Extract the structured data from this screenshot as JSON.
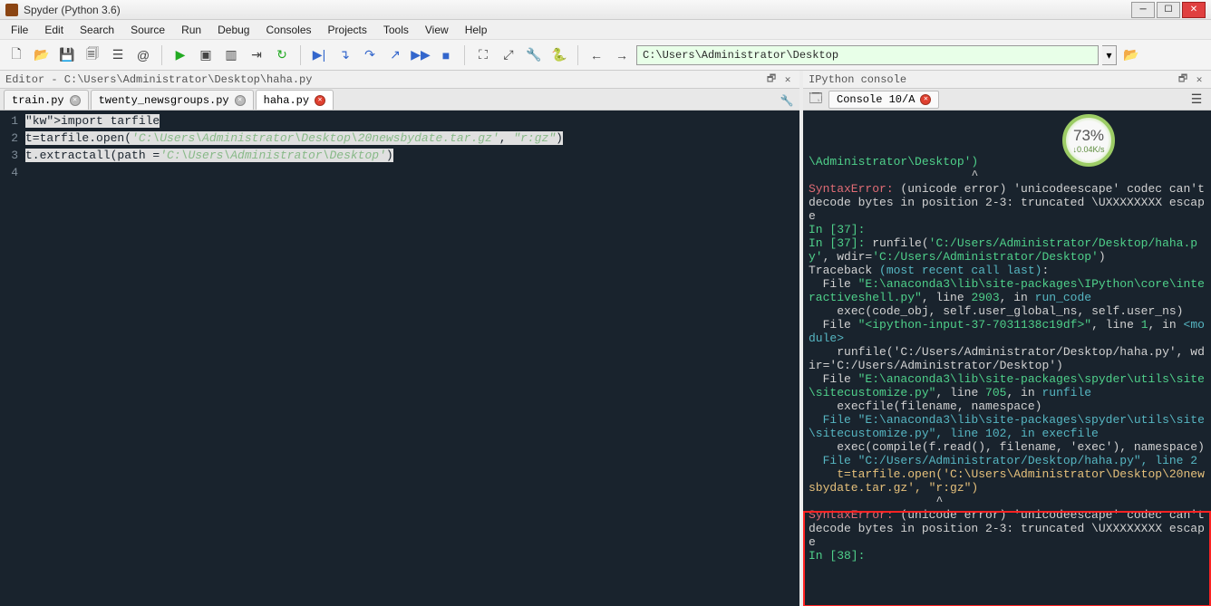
{
  "title": "Spyder (Python 3.6)",
  "menus": [
    "File",
    "Edit",
    "Search",
    "Source",
    "Run",
    "Debug",
    "Consoles",
    "Projects",
    "Tools",
    "View",
    "Help"
  ],
  "path_field": "C:\\Users\\Administrator\\Desktop",
  "editor_header": "Editor - C:\\Users\\Administrator\\Desktop\\haha.py",
  "editor_tabs": [
    {
      "label": "train.py",
      "close": "grey"
    },
    {
      "label": "twenty_newsgroups.py",
      "close": "grey"
    },
    {
      "label": "haha.py",
      "close": "red",
      "active": true
    }
  ],
  "code_lines": [
    {
      "n": "1",
      "raw": "import tarfile",
      "hl": true
    },
    {
      "n": "2",
      "raw": "t=tarfile.open('C:\\Users\\Administrator\\Desktop\\20newsbydate.tar.gz', \"r:gz\")",
      "hl": true
    },
    {
      "n": "3",
      "raw": "t.extractall(path ='C:\\Users\\Administrator\\Desktop')",
      "hl": true
    },
    {
      "n": "4",
      "raw": ""
    }
  ],
  "ipython_header": "IPython console",
  "console_tab": "Console 10/A",
  "badge": {
    "pct": "73%",
    "rate": "↓0.04K/s"
  },
  "console_lines": [
    {
      "t": "\\Administrator\\Desktop')",
      "cls": "c-green"
    },
    {
      "t": "                       ^",
      "cls": ""
    },
    {
      "t": "SyntaxError: (unicode error) 'unicodeescape' codec can't decode bytes in position 2-3: truncated \\UXXXXXXXX escape",
      "cls": "",
      "err": true
    },
    {
      "t": "",
      "cls": ""
    },
    {
      "t": "",
      "cls": ""
    },
    {
      "t": "In [37]:",
      "cls": "c-green"
    },
    {
      "t": "",
      "cls": ""
    },
    {
      "t": "In [37]: runfile('C:/Users/Administrator/Desktop/haha.py', wdir='C:/Users/Administrator/Desktop')",
      "cls": "",
      "runfile": true
    },
    {
      "t": "Traceback (most recent call last):",
      "cls": "",
      "trace": true
    },
    {
      "t": "",
      "cls": ""
    },
    {
      "t": "  File \"E:\\anaconda3\\lib\\site-packages\\IPython\\core\\interactiveshell.py\", line 2903, in run_code",
      "cls": "",
      "file1": true
    },
    {
      "t": "    exec(code_obj, self.user_global_ns, self.user_ns)",
      "cls": ""
    },
    {
      "t": "",
      "cls": ""
    },
    {
      "t": "  File \"<ipython-input-37-7031138c19df>\", line 1, in <module>",
      "cls": "",
      "file2": true
    },
    {
      "t": "    runfile('C:/Users/Administrator/Desktop/haha.py', wdir='C:/Users/Administrator/Desktop')",
      "cls": ""
    },
    {
      "t": "",
      "cls": ""
    },
    {
      "t": "  File \"E:\\anaconda3\\lib\\site-packages\\spyder\\utils\\site\\sitecustomize.py\", line 705, in runfile",
      "cls": "",
      "file3": true
    },
    {
      "t": "    execfile(filename, namespace)",
      "cls": ""
    },
    {
      "t": "",
      "cls": ""
    },
    {
      "t": "  File \"E:\\anaconda3\\lib\\site-packages\\spyder\\utils\\site\\sitecustomize.py\", line 102, in execfile",
      "cls": "c-cyan",
      "file4": true
    },
    {
      "t": "    exec(compile(f.read(), filename, 'exec'), namespace)",
      "cls": ""
    },
    {
      "t": "",
      "cls": ""
    },
    {
      "t": "  File \"C:/Users/Administrator/Desktop/haha.py\", line 2",
      "cls": "c-cyan",
      "file5": true
    },
    {
      "t": "    t=tarfile.open('C:\\Users\\Administrator\\Desktop\\20newsbydate.tar.gz', \"r:gz\")",
      "cls": "c-yellow"
    },
    {
      "t": "                  ^",
      "cls": ""
    },
    {
      "t": "SyntaxError: (unicode error) 'unicodeescape' codec can't decode bytes in position 2-3: truncated \\UXXXXXXXX escape",
      "cls": "",
      "err": true
    },
    {
      "t": "",
      "cls": ""
    },
    {
      "t": "",
      "cls": ""
    },
    {
      "t": "In [38]:",
      "cls": "c-green"
    }
  ]
}
